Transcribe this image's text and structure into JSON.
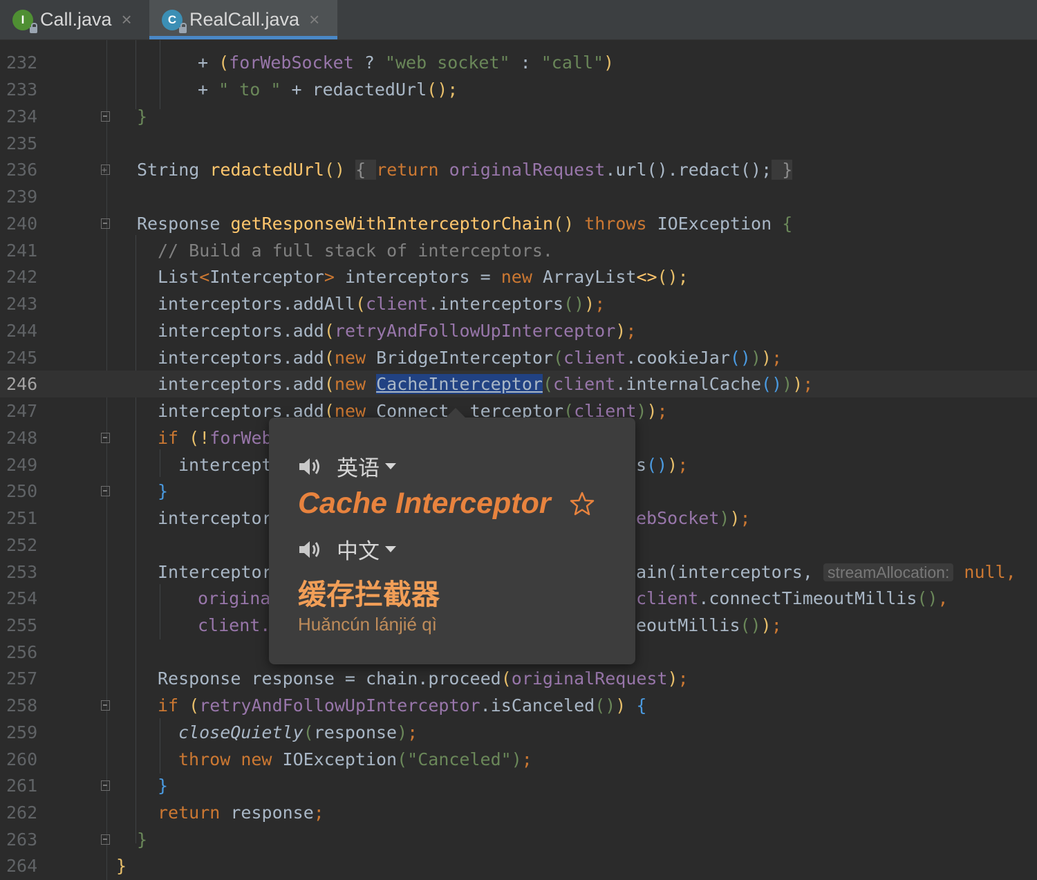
{
  "tabs": [
    {
      "label": "Call.java",
      "icon": "interface-icon",
      "badge": "I",
      "color": "#4f8f33",
      "active": false
    },
    {
      "label": "RealCall.java",
      "icon": "class-icon",
      "badge": "C",
      "color": "#3c8fb5",
      "active": true
    }
  ],
  "line_numbers": [
    "232",
    "233",
    "234",
    "235",
    "236",
    "239",
    "240",
    "241",
    "242",
    "243",
    "244",
    "245",
    "246",
    "247",
    "248",
    "249",
    "250",
    "251",
    "252",
    "253",
    "254",
    "255",
    "256",
    "257",
    "258",
    "259",
    "260",
    "261",
    "262",
    "263",
    "264"
  ],
  "current_line": "246",
  "code": {
    "l232": {
      "plus": "+ ",
      "paren": "(",
      "field": "forWebSocket",
      "q": " ? ",
      "s1": "\"web socket\"",
      "colon": " : ",
      "s2": "\"call\"",
      "close": ")"
    },
    "l233": {
      "plus": "+ ",
      "s1": "\" to \"",
      "mid": " + ",
      "fn": "redactedUrl",
      "end": "();"
    },
    "l234": {
      "brace": "}"
    },
    "l236": {
      "type": "String ",
      "fn": "redactedUrl",
      "paren": "() ",
      "ob": "{ ",
      "kw": "return ",
      "field": "originalRequest",
      "rest": ".url().redact();",
      "cb": " }"
    },
    "l240": {
      "type": "Response ",
      "fn": "getResponseWithInterceptorChain",
      "paren": "() ",
      "kw": "throws ",
      "exc": "IOException ",
      "ob": "{"
    },
    "l241": {
      "comment": "// Build a full stack of interceptors."
    },
    "l242": {
      "a": "List",
      "lt": "<",
      "b": "Interceptor",
      "gt": ">",
      "c": " interceptors = ",
      "kw": "new ",
      "d": "ArrayList",
      "e": "<>",
      "f": "();"
    },
    "l243": {
      "a": "interceptors.addAll",
      "p1": "(",
      "field": "client",
      "b": ".interceptors",
      "p2": "()",
      "p3": ")",
      "end": ";"
    },
    "l244": {
      "a": "interceptors.add",
      "p1": "(",
      "field": "retryAndFollowUpInterceptor",
      "p3": ")",
      "end": ";"
    },
    "l245": {
      "a": "interceptors.add",
      "p1": "(",
      "kw": "new ",
      "b": "BridgeInterceptor",
      "p2": "(",
      "field": "client",
      "c": ".cookieJar",
      "p4": "()",
      "p5": ")",
      "p3": ")",
      "end": ";"
    },
    "l246": {
      "a": "interceptors.add",
      "p1": "(",
      "kw": "new ",
      "sel": "CacheInterceptor",
      "p2": "(",
      "field": "client",
      "c": ".internalCache",
      "p4": "()",
      "p5": ")",
      "p3": ")",
      "end": ";"
    },
    "l247": {
      "a": "interceptors.add",
      "p1": "(",
      "kw": "new ",
      "b": "Connect",
      "c": "terceptor",
      "p2": "(",
      "field": "client",
      "p5": ")",
      "p3": ")",
      "end": ";"
    },
    "l248": {
      "kw": "if ",
      "p": "(!",
      "field": "forWeb"
    },
    "l249": {
      "a": "intercept",
      "b": "s",
      "p4": "()",
      "p3": ")",
      "end": ";"
    },
    "l250": {
      "brace": "}"
    },
    "l251": {
      "a": "interceptor",
      "b": "ebSocket",
      "p5": ")",
      "p3": ")",
      "end": ";"
    },
    "l253": {
      "a": "Interceptor",
      "b": "ain(interceptors,",
      "hint": "streamAllocation:",
      "kw": "null,"
    },
    "l254": {
      "field": "origina",
      "field2": "client",
      "b": ".connectTimeoutMillis",
      "p4": "()",
      "end": ","
    },
    "l255": {
      "field": "client.",
      "b": "eoutMillis",
      "p4": "()",
      "p3": ")",
      "end": ";"
    },
    "l257": {
      "a": "Response response = chain.proceed",
      "p1": "(",
      "field": "originalRequest",
      "p3": ")",
      "end": ";"
    },
    "l258": {
      "kw": "if ",
      "p1": "(",
      "field": "retryAndFollowUpInterceptor",
      "b": ".isCanceled",
      "p2": "()",
      "p3": ")",
      "ob": " {"
    },
    "l259": {
      "fn": "closeQuietly",
      "p1": "(",
      "a": "response",
      "p3": ")",
      "end": ";"
    },
    "l260": {
      "kw": "throw ",
      "kw2": "new ",
      "a": "IOException",
      "p1": "(",
      "s": "\"Canceled\"",
      "p3": ")",
      "end": ";"
    },
    "l261": {
      "brace": "}"
    },
    "l262": {
      "kw": "return ",
      "a": "response",
      "end": ";"
    },
    "l263": {
      "brace": "}"
    },
    "l264": {
      "brace": "}"
    }
  },
  "popup": {
    "source_lang": "英语",
    "word": "Cache Interceptor",
    "target_lang": "中文",
    "translation": "缓存拦截器",
    "pinyin": "Huǎncún lánjié qì"
  },
  "colors": {
    "keyword": "#cc7832",
    "string": "#6a8759",
    "field": "#9876aa",
    "method": "#ffc66d",
    "accent": "#4a88c7",
    "popup_word": "#e8833e"
  }
}
